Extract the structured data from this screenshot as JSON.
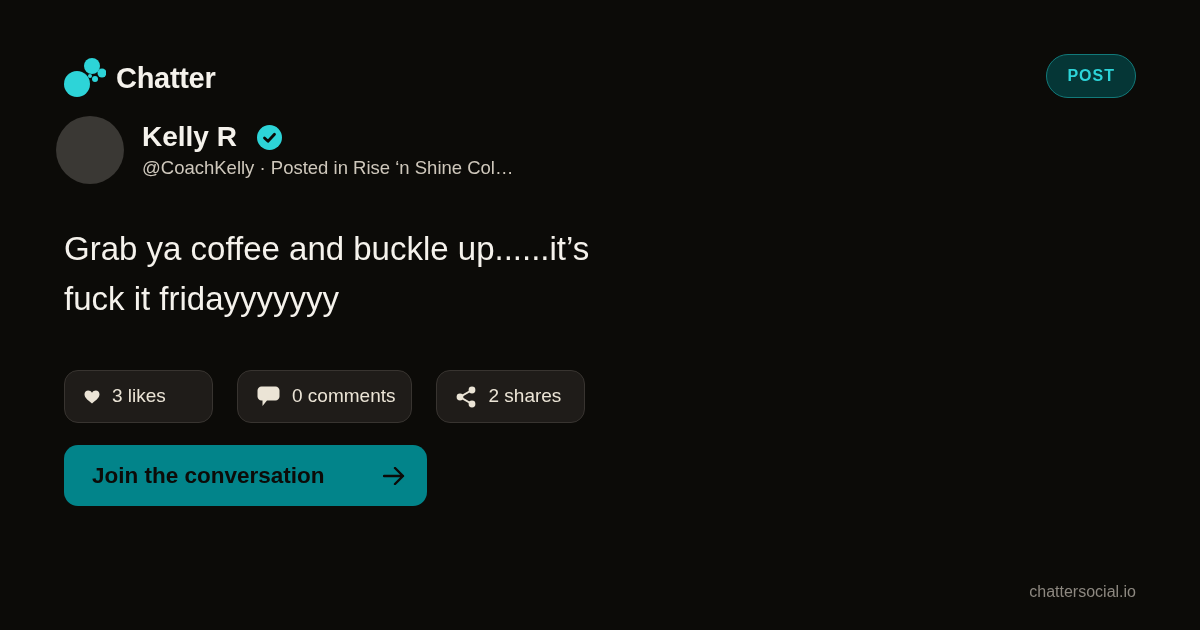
{
  "brand": {
    "name": "Chatter"
  },
  "badge": {
    "label": "POST"
  },
  "author": {
    "name": "Kelly R",
    "verified": true,
    "meta": "@CoachKelly · Posted in Rise ‘n Shine Col…"
  },
  "post": {
    "text": "Grab ya coffee and buckle up......it’s fuck it fridayyyyyyy"
  },
  "stats": [
    {
      "kind": "likes",
      "label": "3 likes"
    },
    {
      "kind": "comments",
      "label": "0 comments"
    },
    {
      "kind": "shares",
      "label": "2 shares"
    }
  ],
  "cta": {
    "label": "Join the conversation"
  },
  "footer": {
    "domain": "chattersocial.io"
  }
}
